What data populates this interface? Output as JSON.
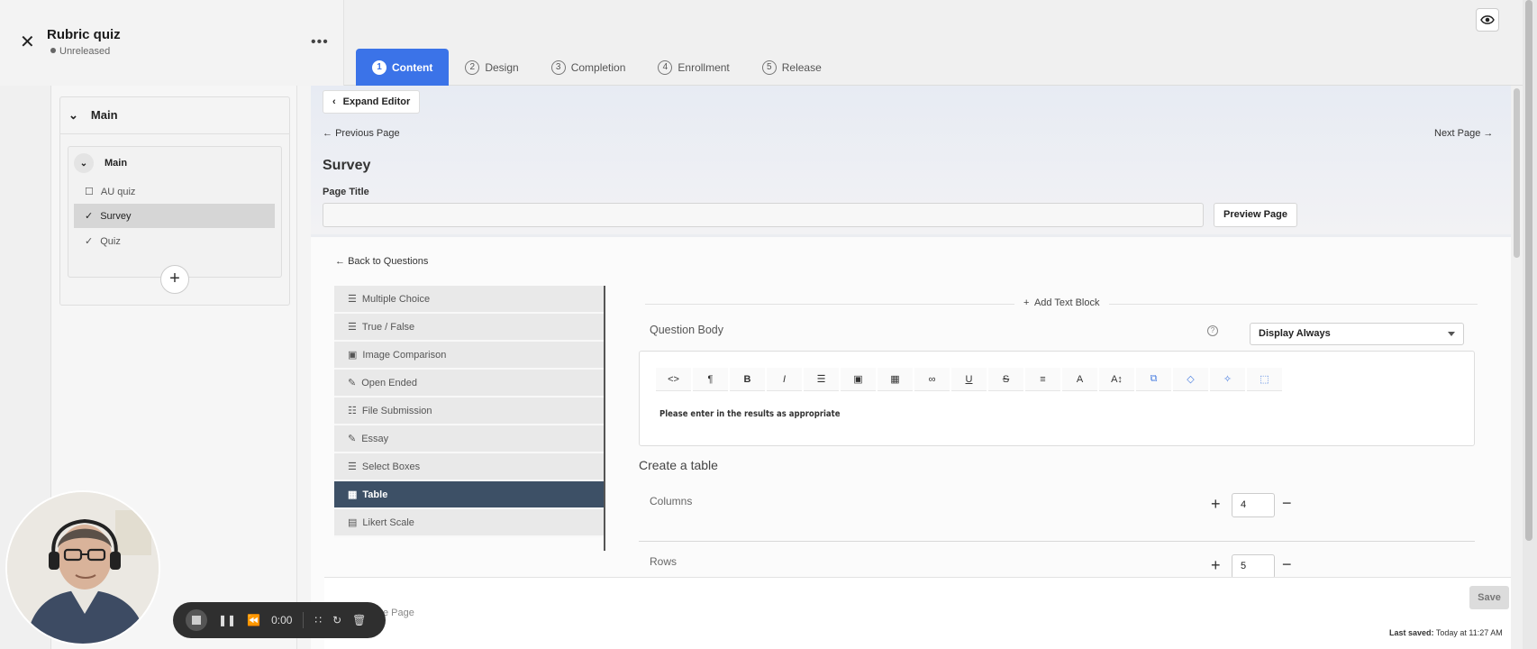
{
  "quiz": {
    "title": "Rubric quiz",
    "status": "Unreleased",
    "more_label": "•••"
  },
  "steps": [
    {
      "num": "1",
      "label": "Content",
      "active": true
    },
    {
      "num": "2",
      "label": "Design",
      "active": false
    },
    {
      "num": "3",
      "label": "Completion",
      "active": false
    },
    {
      "num": "4",
      "label": "Enrollment",
      "active": false
    },
    {
      "num": "5",
      "label": "Release",
      "active": false
    }
  ],
  "outline": {
    "section_title": "Main",
    "group_title": "Main",
    "pages": [
      {
        "label": "AU quiz",
        "icon": "page-icon"
      },
      {
        "label": "Survey",
        "icon": "check-icon",
        "selected": true
      },
      {
        "label": "Quiz",
        "icon": "check-icon"
      }
    ]
  },
  "editor": {
    "expand_label": "Expand Editor",
    "prev_label": "Previous Page",
    "next_label": "Next Page",
    "page_heading": "Survey",
    "page_title_label": "Page Title",
    "page_title_value": "",
    "preview_label": "Preview Page",
    "back_label": "Back to Questions"
  },
  "question_types": [
    {
      "label": "Multiple Choice",
      "icon": "list-icon"
    },
    {
      "label": "True / False",
      "icon": "list-icon"
    },
    {
      "label": "Image Comparison",
      "icon": "image-icon"
    },
    {
      "label": "Open Ended",
      "icon": "edit-icon"
    },
    {
      "label": "File Submission",
      "icon": "file-icon"
    },
    {
      "label": "Essay",
      "icon": "edit-icon"
    },
    {
      "label": "Select Boxes",
      "icon": "list-icon"
    },
    {
      "label": "Table",
      "icon": "table-icon",
      "selected": true
    },
    {
      "label": "Likert Scale",
      "icon": "scale-icon"
    }
  ],
  "question": {
    "add_text_block": "Add Text Block",
    "body_label": "Question Body",
    "display_value": "Display Always",
    "body_text": "Please enter in the results as appropriate",
    "toolbar": [
      "<>",
      "¶",
      "B",
      "I",
      "☰",
      "▣",
      "▦",
      "∞",
      "U",
      "S",
      "≡",
      "A",
      "A↕",
      "⧉",
      "◇",
      "✧",
      "⬚"
    ]
  },
  "table_config": {
    "heading": "Create a table",
    "columns_label": "Columns",
    "columns_value": "4",
    "rows_label": "Rows",
    "rows_value": "5"
  },
  "footer": {
    "save_label": "Save",
    "last_saved_label": "Last saved:",
    "last_saved_value": "Today at 11:27 AM",
    "delete_label": "e Page"
  },
  "recorder": {
    "time": "0:00"
  },
  "colors": {
    "accent": "#3b73e8",
    "selected_type": "#3d5066"
  }
}
